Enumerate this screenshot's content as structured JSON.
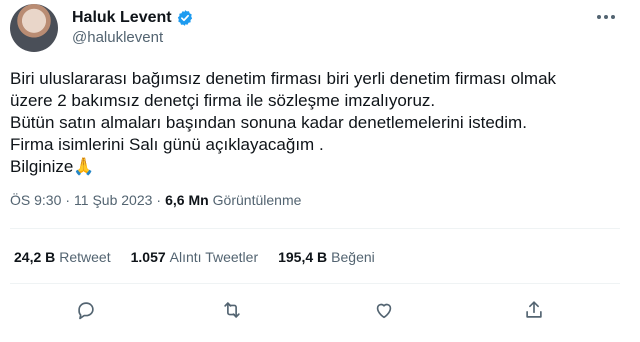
{
  "author": {
    "name": "Haluk Levent",
    "handle": "@haluklevent"
  },
  "tweet_lines": [
    "Biri uluslararası bağımsız denetim firması biri yerli denetim firması olmak",
    "üzere 2 bakımsız denetçi firma ile sözleşme imzalıyoruz.",
    "Bütün satın almaları başından sonuna kadar denetlemelerini istedim.",
    "Firma isimlerini Salı günü açıklayacağım .",
    "Bilginize🙏"
  ],
  "meta": {
    "time": "ÖS 9:30",
    "dot1": "·",
    "date": "11 Şub 2023",
    "dot2": "·",
    "views_value": "6,6 Mn",
    "views_label": "Görüntülenme"
  },
  "stats": {
    "retweets_value": "24,2 B",
    "retweets_label": "Retweet",
    "quotes_value": "1.057",
    "quotes_label": "Alıntı Tweetler",
    "likes_value": "195,4 B",
    "likes_label": "Beğeni"
  },
  "icons": {
    "verified": "verified-badge-icon",
    "more": "more-options-icon",
    "reply": "reply-icon",
    "retweet": "retweet-icon",
    "like": "heart-icon",
    "share": "share-icon"
  },
  "colors": {
    "verified": "#1d9bf0",
    "text": "#0f1419",
    "secondary": "#536471",
    "divider": "#eff3f4"
  }
}
